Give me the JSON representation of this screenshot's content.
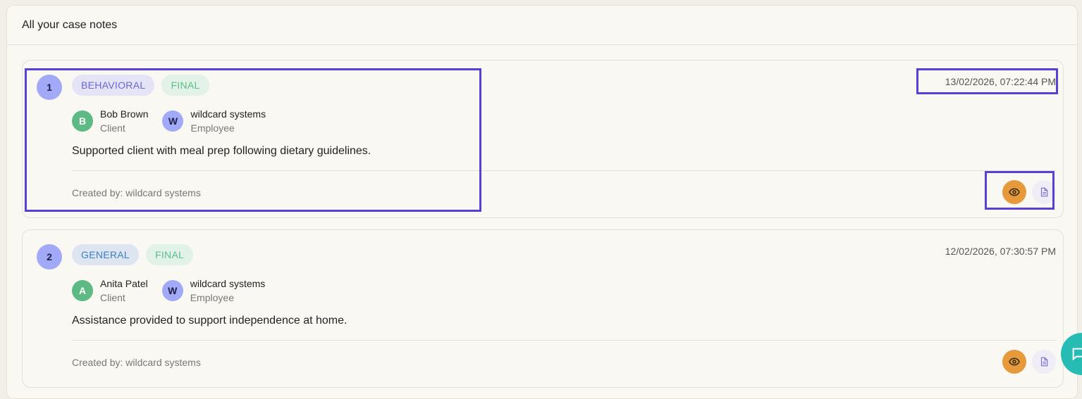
{
  "header": {
    "title": "All your case notes"
  },
  "notes": [
    {
      "number": "1",
      "category": "BEHAVIORAL",
      "status": "FINAL",
      "timestamp": "13/02/2026, 07:22:44 PM",
      "client": {
        "initial": "B",
        "name": "Bob Brown",
        "role": "Client"
      },
      "employee": {
        "initial": "W",
        "name": "wildcard systems",
        "role": "Employee"
      },
      "text": "Supported client with meal prep following dietary guidelines.",
      "created_by": "Created by: wildcard systems"
    },
    {
      "number": "2",
      "category": "GENERAL",
      "status": "FINAL",
      "timestamp": "12/02/2026, 07:30:57 PM",
      "client": {
        "initial": "A",
        "name": "Anita Patel",
        "role": "Client"
      },
      "employee": {
        "initial": "W",
        "name": "wildcard systems",
        "role": "Employee"
      },
      "text": "Assistance provided to support independence at home.",
      "created_by": "Created by: wildcard systems"
    }
  ],
  "icons": {
    "view": "eye-icon",
    "document": "document-icon",
    "chat": "chat-icon"
  },
  "colors": {
    "accent_orange": "#e69a3b",
    "highlight": "#5a3fd8",
    "avatar_green": "#5dba84",
    "avatar_purple": "#a2a9f6",
    "chat_teal": "#26bcb3"
  }
}
